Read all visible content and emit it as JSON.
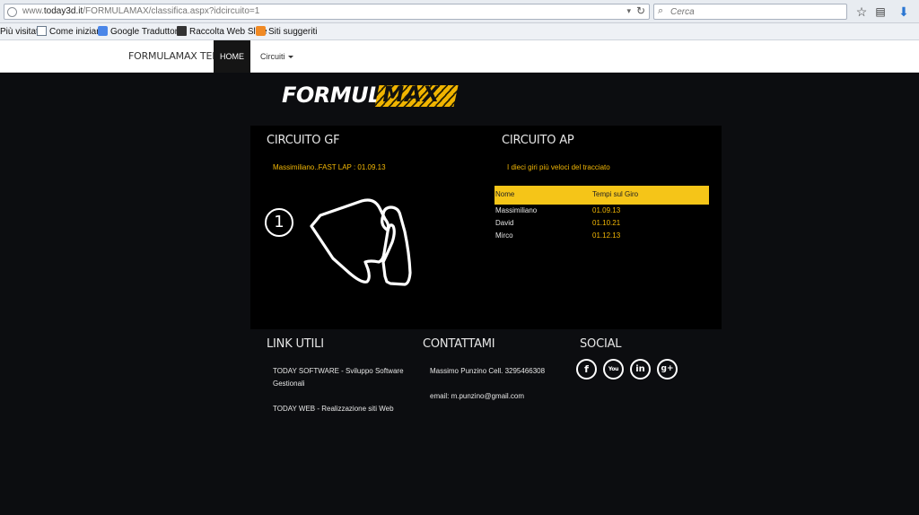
{
  "browser": {
    "url_prefix": "www.",
    "url_domain": "today3d.it",
    "url_path": "/FORMULAMAX/classifica.aspx?idcircuito=1",
    "search_placeholder": "Cerca",
    "bookmarks": [
      {
        "label": "Più visitati",
        "icon": "bookmark-folder-icon"
      },
      {
        "label": "Come iniziare",
        "icon": "page-icon"
      },
      {
        "label": "Google Traduttore",
        "icon": "translate-icon"
      },
      {
        "label": "Raccolta Web Slice",
        "icon": "web-slice-icon"
      },
      {
        "label": "Siti suggeriti",
        "icon": "suggested-sites-icon"
      }
    ]
  },
  "navbar": {
    "brand": "FORMULAMAX TEMPI",
    "home": "HOME",
    "circuiti": "Circuiti"
  },
  "logo": {
    "word1": "FORMULA",
    "word2": "MAX"
  },
  "left_panel": {
    "title": "CIRCUITO GF",
    "fast_lap": "Massimiliano..FAST LAP : 01.09.13",
    "badge": "1"
  },
  "right_panel": {
    "title": "CIRCUITO AP",
    "subtitle": "I dieci giri più veloci del tracciato",
    "columns": [
      "Nome",
      "Tempi sul Giro"
    ],
    "rows": [
      {
        "name": "Massimiliano",
        "time": "01.09.13"
      },
      {
        "name": "David",
        "time": "01.10.21"
      },
      {
        "name": "Mirco",
        "time": "01.12.13"
      }
    ]
  },
  "footer": {
    "link_utili": {
      "title": "LINK UTILI",
      "items": [
        "TODAY SOFTWARE - Sviluppo Software Gestionali",
        "TODAY WEB - Realizzazione siti Web"
      ]
    },
    "contattami": {
      "title": "CONTATTAMI",
      "phone": "Massimo Punzino Cell. 3295466308",
      "email": "email: m.punzino@gmail.com"
    },
    "social": {
      "title": "SOCIAL",
      "items": [
        {
          "glyph": "f",
          "icon": "facebook-icon"
        },
        {
          "glyph": "You",
          "icon": "youtube-icon"
        },
        {
          "glyph": "in",
          "icon": "linkedin-icon"
        },
        {
          "glyph": "g+",
          "icon": "google-plus-icon"
        }
      ]
    }
  },
  "colors": {
    "accent": "#f5c518",
    "background": "#0c0d10",
    "panel": "#000000"
  }
}
